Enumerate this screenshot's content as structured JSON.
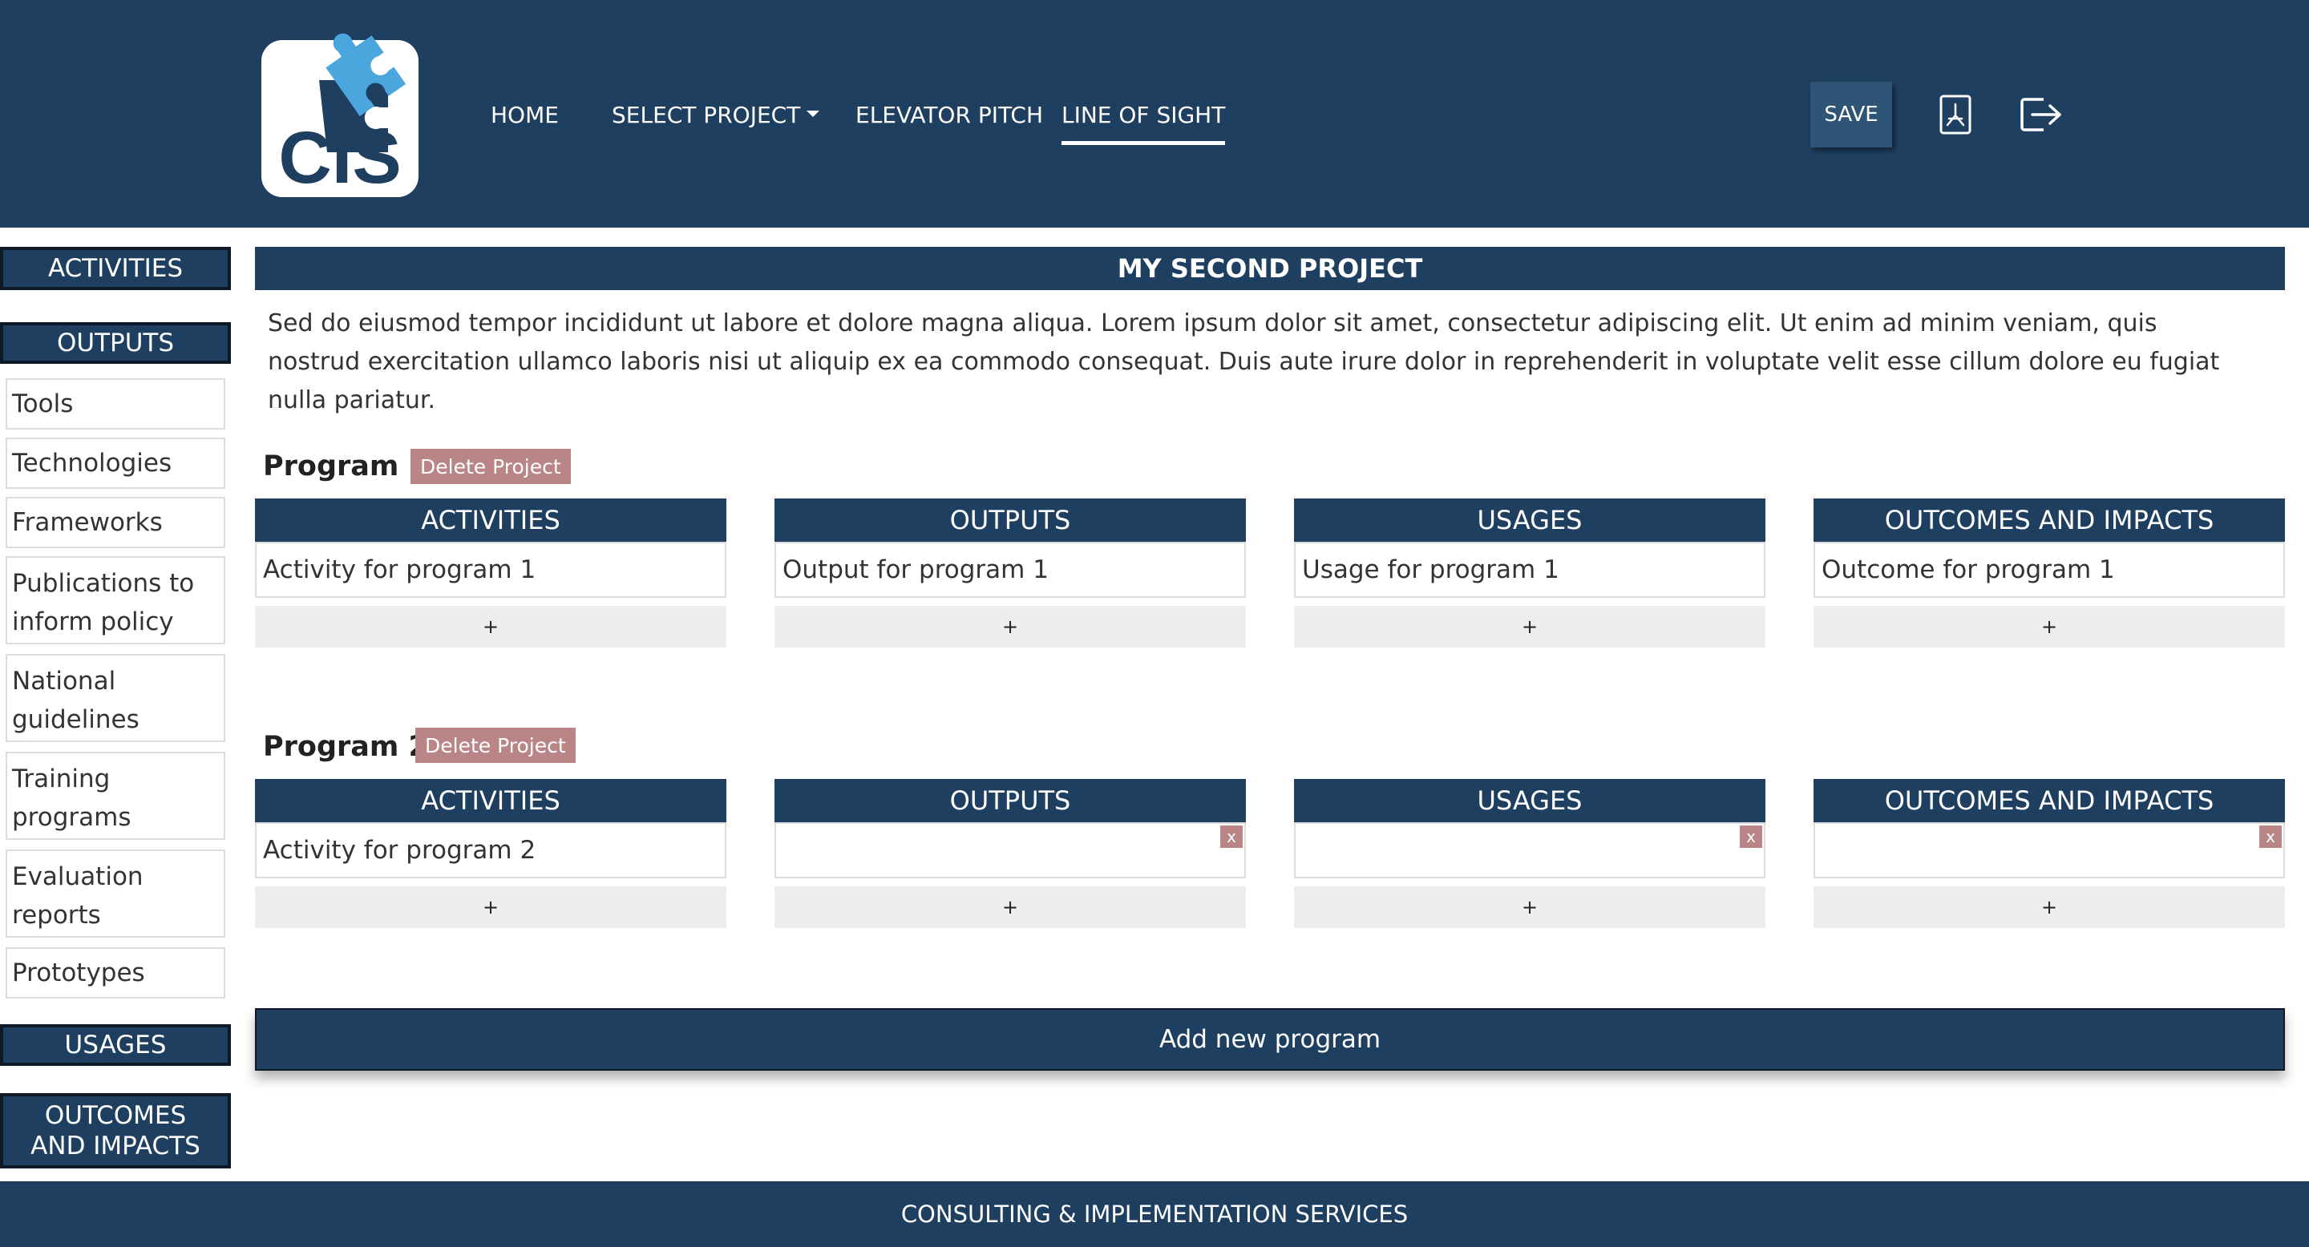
{
  "header": {
    "logo_text": "CIS",
    "nav": {
      "home": "HOME",
      "select_project": "SELECT PROJECT",
      "elevator_pitch": "ELEVATOR PITCH",
      "line_of_sight": "LINE OF SIGHT"
    },
    "save_label": "SAVE",
    "pdf_icon": "pdf-icon",
    "logout_icon": "logout-icon"
  },
  "sidebar": {
    "activities": "ACTIVITIES",
    "outputs": "OUTPUTS",
    "output_items": [
      "Tools",
      "Technologies",
      "Frameworks",
      "Publications to inform policy",
      "National guidelines",
      "Training programs",
      "Evaluation reports",
      "Prototypes"
    ],
    "usages": "USAGES",
    "outcomes": "OUTCOMES AND IMPACTS"
  },
  "project": {
    "title": "MY SECOND PROJECT",
    "description": "Sed do eiusmod tempor incididunt ut labore et dolore magna aliqua. Lorem ipsum dolor sit amet, consectetur adipiscing elit. Ut enim ad minim veniam, quis nostrud exercitation ullamco laboris nisi ut aliquip ex ea commodo consequat. Duis aute irure dolor in reprehenderit in voluptate velit esse cillum dolore eu fugiat nulla pariatur."
  },
  "columns": [
    "ACTIVITIES",
    "OUTPUTS",
    "USAGES",
    "OUTCOMES AND IMPACTS"
  ],
  "programs": [
    {
      "name": "Program 1",
      "delete_label": "Delete Project",
      "cells": [
        "Activity for program 1",
        "Output for program 1",
        "Usage for program 1",
        "Outcome for program 1"
      ]
    },
    {
      "name": "Program 2",
      "delete_label": "Delete Project",
      "cells": [
        "Activity for program 2",
        "",
        "",
        ""
      ]
    }
  ],
  "add_label": "+",
  "remove_label": "x",
  "add_program_label": "Add new program",
  "footer_text": "CONSULTING & IMPLEMENTATION SERVICES",
  "colors": {
    "navy": "#1e3f60",
    "delete": "#b98586",
    "logo_puzzle": "#4aa6dd"
  }
}
